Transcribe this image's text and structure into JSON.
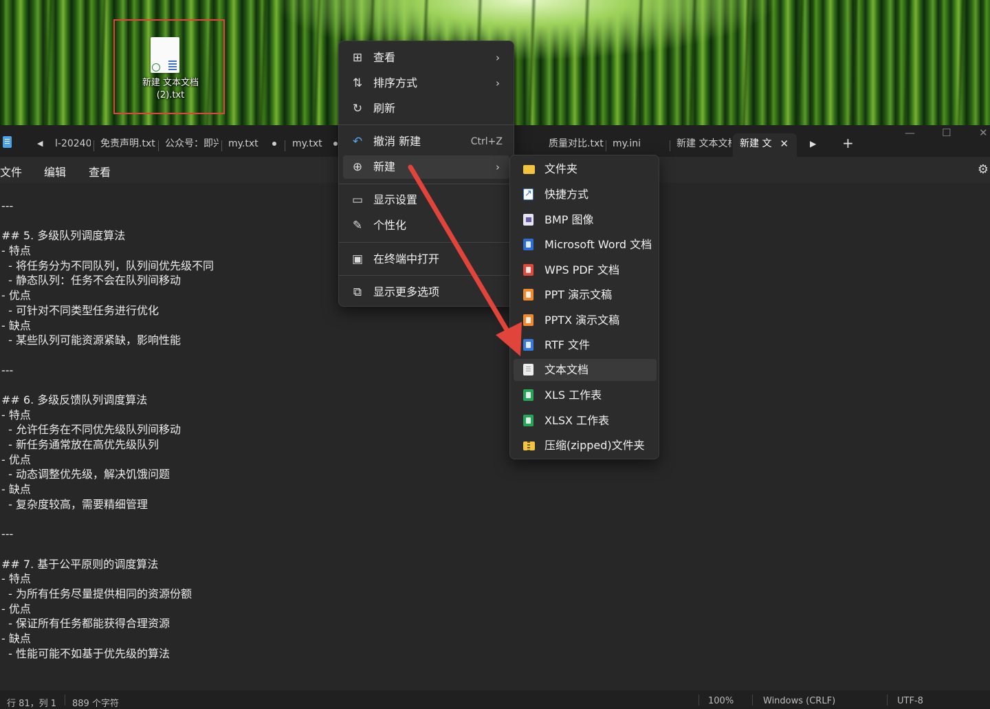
{
  "desktop": {
    "file_label": "新建 文本文档 (2).txt"
  },
  "window": {
    "tabs": [
      {
        "label": "l-20240"
      },
      {
        "label": "免责声明.txt"
      },
      {
        "label": "公众号：即兴"
      },
      {
        "label": "my.txt"
      },
      {
        "label": "my.txt"
      },
      {
        "label": "质量对比.txt"
      },
      {
        "label": "my.ini"
      },
      {
        "label": "新建 文本文档"
      },
      {
        "label": "新建 文"
      }
    ],
    "minimize": "—",
    "maximize": "☐",
    "close": "✕",
    "tab_close": "✕",
    "add_tab": "+"
  },
  "menubar": {
    "file": "文件",
    "edit": "编辑",
    "view": "查看"
  },
  "editor": {
    "lines": [
      "---",
      "",
      "## 5. 多级队列调度算法",
      "- 特点",
      "  - 将任务分为不同队列，队列间优先级不同",
      "  - 静态队列：任务不会在队列间移动",
      "- 优点",
      "  - 可针对不同类型任务进行优化",
      "- 缺点",
      "  - 某些队列可能资源紧缺，影响性能",
      "",
      "---",
      "",
      "## 6. 多级反馈队列调度算法",
      "- 特点",
      "  - 允许任务在不同优先级队列间移动",
      "  - 新任务通常放在高优先级队列",
      "- 优点",
      "  - 动态调整优先级，解决饥饿问题",
      "- 缺点",
      "  - 复杂度较高，需要精细管理",
      "",
      "---",
      "",
      "## 7. 基于公平原则的调度算法",
      "- 特点",
      "  - 为所有任务尽量提供相同的资源份额",
      "- 优点",
      "  - 保证所有任务都能获得合理资源",
      "- 缺点",
      "  - 性能可能不如基于优先级的算法"
    ]
  },
  "status": {
    "position": "行 81，列 1",
    "chars": "889 个字符",
    "zoom": "100%",
    "line_ending": "Windows (CRLF)",
    "encoding": "UTF-8"
  },
  "context_menu": {
    "view": "查看",
    "sort": "排序方式",
    "refresh": "刷新",
    "undo": "撤消 新建",
    "undo_shortcut": "Ctrl+Z",
    "new": "新建",
    "display": "显示设置",
    "personalize": "个性化",
    "terminal": "在终端中打开",
    "more": "显示更多选项"
  },
  "new_submenu": {
    "items": [
      {
        "label": "文件夹",
        "icon": "folder-icon"
      },
      {
        "label": "快捷方式",
        "icon": "shortcut-icon"
      },
      {
        "label": "BMP 图像",
        "icon": "bmp-icon"
      },
      {
        "label": "Microsoft Word 文档",
        "icon": "word-icon"
      },
      {
        "label": "WPS PDF 文档",
        "icon": "pdf-icon"
      },
      {
        "label": "PPT 演示文稿",
        "icon": "ppt-icon"
      },
      {
        "label": "PPTX 演示文稿",
        "icon": "pptx-icon"
      },
      {
        "label": "RTF 文件",
        "icon": "rtf-icon"
      },
      {
        "label": "文本文档",
        "icon": "text-doc-icon"
      },
      {
        "label": "XLS 工作表",
        "icon": "xls-icon"
      },
      {
        "label": "XLSX 工作表",
        "icon": "xlsx-icon"
      },
      {
        "label": "压缩(zipped)文件夹",
        "icon": "zip-folder-icon"
      }
    ],
    "highlighted": "文本文档"
  },
  "colors": {
    "annotation_red": "#e0443a",
    "accent": "#4aa3e8"
  }
}
